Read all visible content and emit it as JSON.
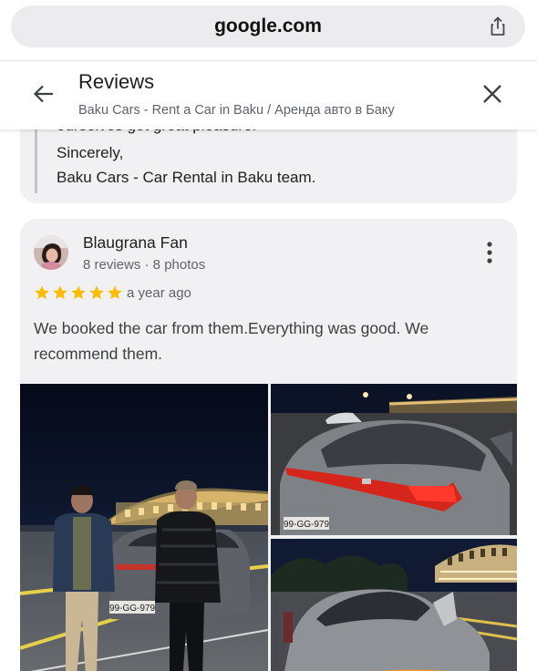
{
  "browser": {
    "url": "google.com",
    "share_icon": "share-icon"
  },
  "header": {
    "title": "Reviews",
    "subtitle": "Baku Cars - Rent a Car in Baku / Аренда авто в Баку",
    "back_icon": "arrow-back-icon",
    "close_icon": "close-icon"
  },
  "previous_reply": {
    "cut_line": "ourselves get great pleasure!",
    "lines": [
      "Sincerely,",
      "Baku Cars - Car Rental in Baku team."
    ]
  },
  "review": {
    "reviewer_name": "Blaugrana Fan",
    "reviewer_meta": "8 reviews · 8 photos",
    "rating": 5,
    "time_ago": "a year ago",
    "text": "We booked the car from them.Everything was good. We recommend them.",
    "photos": [
      {
        "name": "photo-two-men-with-car",
        "plate": "99-GG-979"
      },
      {
        "name": "photo-car-rear-lights",
        "plate": "99-GG-979"
      },
      {
        "name": "photo-car-front-night"
      }
    ]
  },
  "colors": {
    "star": "#fbbc04",
    "card_bg": "#f1f1f3",
    "secondary_text": "#5f6368"
  }
}
